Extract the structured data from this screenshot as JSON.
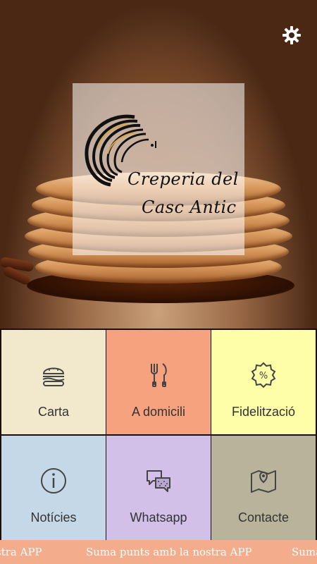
{
  "hero": {
    "background": "pancake-stack-photo",
    "logo": {
      "line1": "Creperia del",
      "line2": "Casc Antic"
    }
  },
  "header": {
    "settings_icon": "gear-icon"
  },
  "menu": {
    "tiles": [
      {
        "label": "Carta",
        "icon": "burger-icon",
        "color": "#f2e8cc"
      },
      {
        "label": "A domicili",
        "icon": "fork-knife-icon",
        "color": "#f6a27e"
      },
      {
        "label": "Fidelització",
        "icon": "discount-badge-icon",
        "color": "#fefda8"
      },
      {
        "label": "Notícies",
        "icon": "info-icon",
        "color": "#c5d8e8"
      },
      {
        "label": "Whatsapp",
        "icon": "chat-bubbles-icon",
        "color": "#d3c0e8"
      },
      {
        "label": "Contacte",
        "icon": "map-pin-icon",
        "color": "#b9b39b"
      }
    ]
  },
  "ticker": {
    "text": "Suma punts amb la nostra APP",
    "fragment_left": "stra APP",
    "fragment_right": "Suma",
    "color": "#f3ad8d"
  }
}
